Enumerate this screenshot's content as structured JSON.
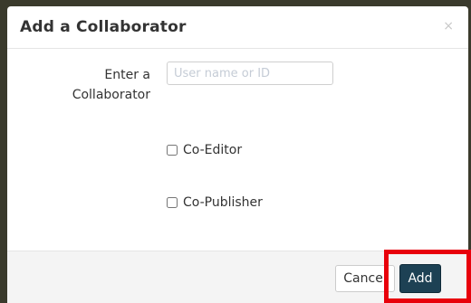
{
  "dialog": {
    "title": "Add a Collaborator",
    "close_glyph": "×"
  },
  "form": {
    "collaborator_label_line1": "Enter a",
    "collaborator_label_line2": "Collaborator",
    "collaborator_input": {
      "placeholder": "User name or ID",
      "value": ""
    },
    "checkboxes": [
      {
        "label": "Co-Editor",
        "checked": false
      },
      {
        "label": "Co-Publisher",
        "checked": false
      }
    ]
  },
  "footer": {
    "cancel_label": "Cancel",
    "add_label": "Add"
  },
  "colors": {
    "primary_button": "#1d4154",
    "highlight": "#e8000b",
    "backdrop": "#3a3a2c"
  }
}
